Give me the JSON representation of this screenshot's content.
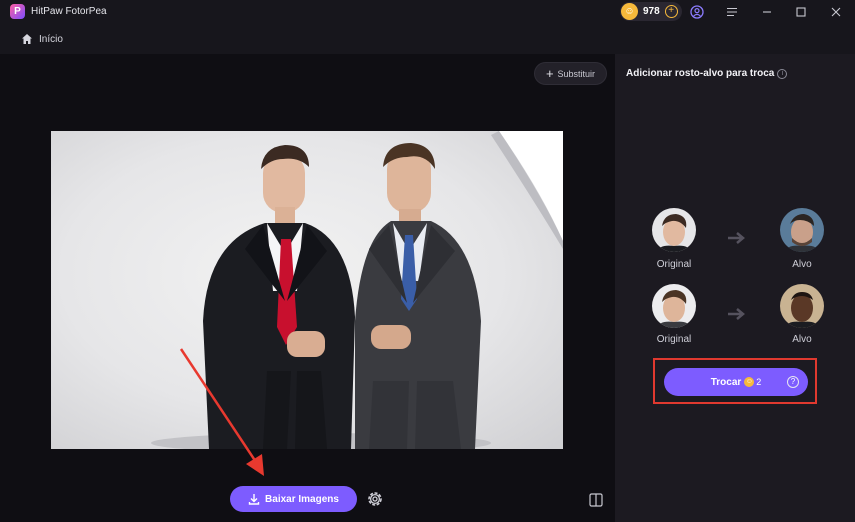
{
  "app": {
    "title": "HitPaw FotorPea",
    "credits": "978",
    "accent": "#7d5cff",
    "coin_color": "#f6b93b",
    "highlight_color": "#e0392f"
  },
  "nav": {
    "home_label": "Início"
  },
  "editor": {
    "replace_label": "Substituir",
    "download_label": "Baixar Imagens"
  },
  "panel": {
    "title": "Adicionar rosto-alvo para troca",
    "pairs": [
      {
        "original_label": "Original",
        "target_label": "Alvo"
      },
      {
        "original_label": "Original",
        "target_label": "Alvo"
      }
    ],
    "swap_label": "Trocar",
    "swap_cost": "2"
  }
}
